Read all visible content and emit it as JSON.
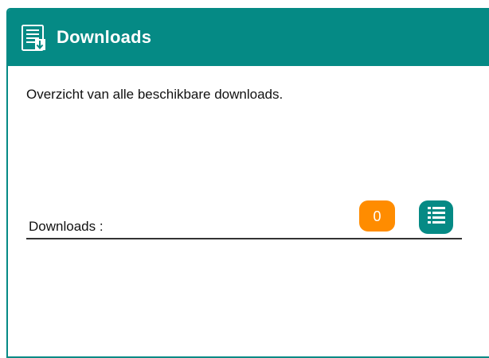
{
  "panel": {
    "title": "Downloads",
    "header_icon": "document-download-icon",
    "description": "Overzicht van alle beschikbare downloads."
  },
  "downloads": {
    "label": "Downloads :",
    "count": "0",
    "list_icon": "list-icon"
  },
  "colors": {
    "header": "#058a85",
    "badge": "#ff8c00",
    "list_button": "#058a85"
  }
}
